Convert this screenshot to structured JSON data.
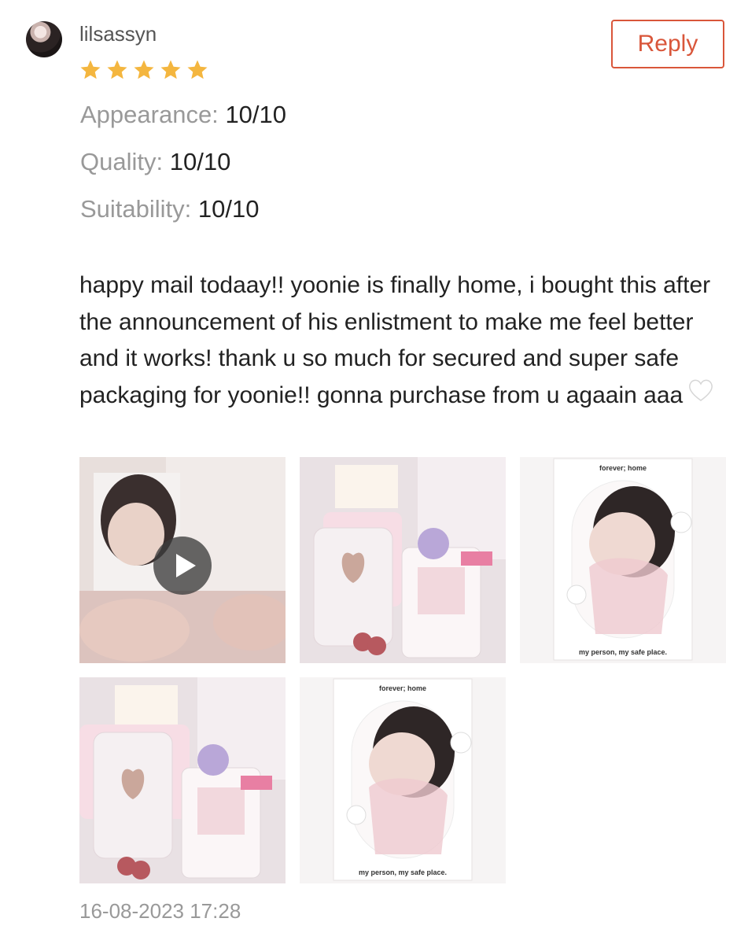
{
  "review": {
    "username": "lilsassyn",
    "rating_stars": 5,
    "reply_label": "Reply",
    "ratings": [
      {
        "label": "Appearance:",
        "value": "10/10"
      },
      {
        "label": "Quality:",
        "value": "10/10"
      },
      {
        "label": "Suitability:",
        "value": "10/10"
      }
    ],
    "text": "happy mail todaay!! yoonie is finally home, i bought this after the announcement of his enlistment to make me feel better and it works! thank u so much for secured and super safe packaging for yoonie!! gonna purchase from u agaain aaa",
    "text_emoji": "white-heart-icon",
    "media": [
      {
        "type": "video",
        "icon": "play-icon"
      },
      {
        "type": "photo"
      },
      {
        "type": "photo",
        "card_top": "forever; home",
        "card_bottom": "my person, my safe place."
      },
      {
        "type": "photo"
      },
      {
        "type": "photo",
        "card_top": "forever; home",
        "card_bottom": "my person, my safe place."
      }
    ],
    "date": "16-08-2023 17:28"
  },
  "colors": {
    "accent": "#d9563a",
    "star": "#f4b63f",
    "muted_text": "#999999"
  }
}
